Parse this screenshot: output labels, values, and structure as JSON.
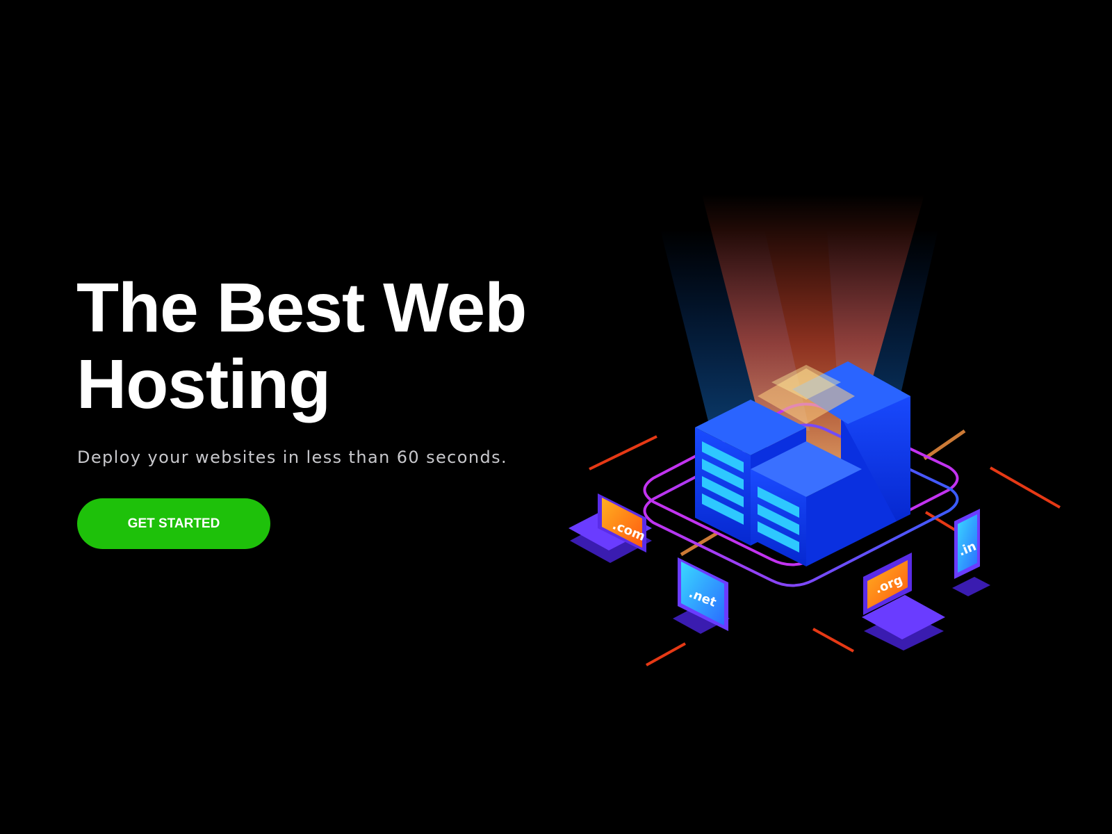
{
  "hero": {
    "headline_line1": "The Best Web",
    "headline_line2": "Hosting",
    "tagline": "Deploy your websites in less than 60 seconds.",
    "cta_label": "GET STARTED"
  },
  "illustration": {
    "domains": {
      "com": ".com",
      "net": ".net",
      "org": ".org",
      "in": ".in"
    }
  },
  "colors": {
    "background": "#000000",
    "headline": "#ffffff",
    "tagline": "#c8c8cc",
    "cta_background": "#1ec10a",
    "cta_text": "#ffffff",
    "server_blue": "#0a3cff",
    "ring_purple": "#c233f0",
    "accent_orange": "#ff5a1e"
  }
}
